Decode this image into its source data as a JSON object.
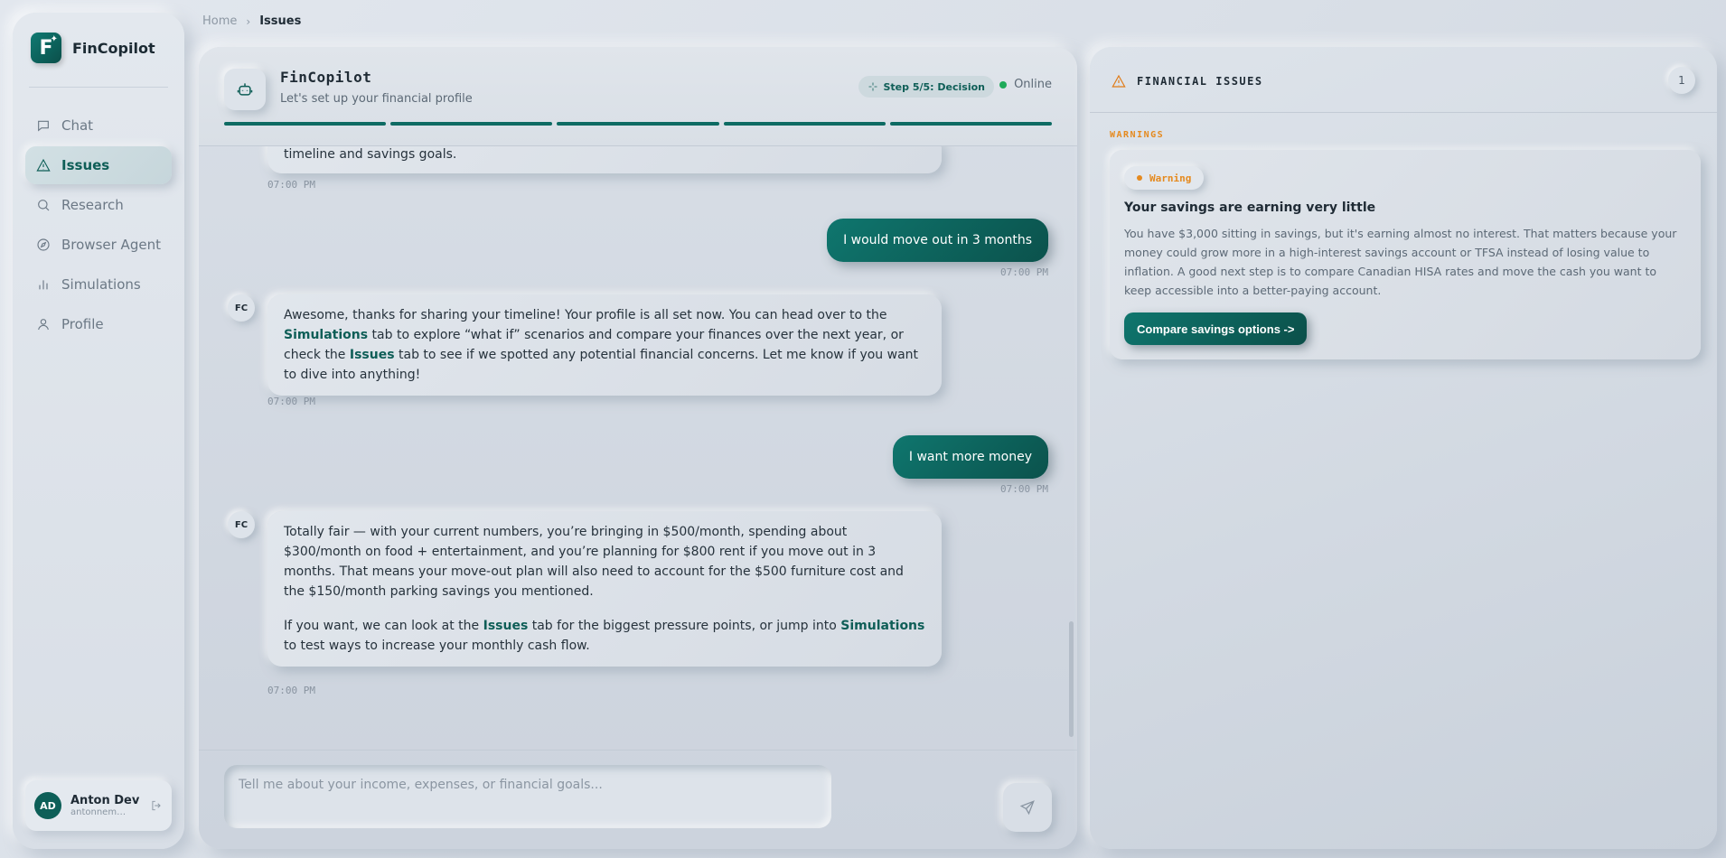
{
  "app": {
    "name": "FinCopilot"
  },
  "sidebar": {
    "items": [
      {
        "label": "Chat",
        "icon": "chat-icon",
        "active": false
      },
      {
        "label": "Issues",
        "icon": "warning-icon",
        "active": true
      },
      {
        "label": "Research",
        "icon": "search-icon",
        "active": false
      },
      {
        "label": "Browser Agent",
        "icon": "compass-icon",
        "active": false
      },
      {
        "label": "Simulations",
        "icon": "bar-chart-icon",
        "active": false
      },
      {
        "label": "Profile",
        "icon": "user-icon",
        "active": false
      }
    ],
    "user": {
      "initials": "AD",
      "name": "Anton Dev",
      "email": "antonnem@..."
    }
  },
  "breadcrumb": {
    "home": "Home",
    "current": "Issues"
  },
  "chat": {
    "title": "FinCopilot",
    "subtitle": "Let's set up your financial profile",
    "step_badge": "Step 5/5: Decision",
    "status": "Online",
    "progress": {
      "completed": 5,
      "total": 5
    },
    "messages": {
      "m0_tail": "timeline and savings goals.",
      "m0_time": "07:00 PM",
      "m1_text": "I would move out in 3 months",
      "m1_time": "07:00 PM",
      "m2_avatar": "FC",
      "m2_parts": [
        "Awesome, thanks for sharing your timeline! Your profile is all set now. You can head over to the ",
        "Simulations",
        " tab to explore “what if” scenarios and compare your finances over the next year, or check the ",
        "Issues",
        " tab to see if we spotted any potential financial concerns. Let me know if you want to dive into anything!"
      ],
      "m2_time": "07:00 PM",
      "m3_text": "I want more money",
      "m3_time": "07:00 PM",
      "m4_avatar": "FC",
      "m4_p1": "Totally fair — with your current numbers, you’re bringing in $500/month, spending about $300/month on food + entertainment, and you’re planning for $800 rent if you move out in 3 months. That means your move-out plan will also need to account for the $500 furniture cost and the $150/month parking savings you mentioned.",
      "m4_p2_parts": [
        "If you want, we can look at the ",
        "Issues",
        " tab for the biggest pressure points, or jump into ",
        "Simulations",
        " to test ways to increase your monthly cash flow."
      ],
      "m4_time": "07:00 PM"
    },
    "composer": {
      "placeholder": "Tell me about your income, expenses, or financial goals..."
    }
  },
  "issues": {
    "title": "FINANCIAL ISSUES",
    "count": "1",
    "section": "WARNINGS",
    "card": {
      "severity": "Warning",
      "title": "Your savings are earning very little",
      "body": "You have $3,000 sitting in savings, but it's earning almost no interest. That matters because your money could grow more in a high-interest savings account or TFSA instead of losing value to inflation. A good next step is to compare Canadian HISA rates and move the cash you want to keep accessible into a better-paying account.",
      "cta": "Compare savings options ->"
    }
  },
  "colors": {
    "accent": "#0e6b63",
    "warning": "#e58a1f",
    "online": "#1faa59"
  }
}
